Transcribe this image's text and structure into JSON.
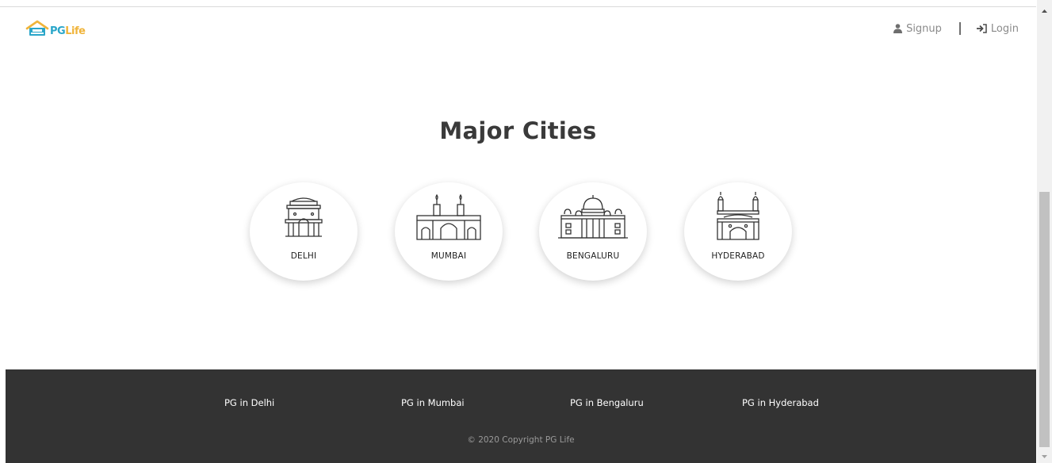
{
  "app": {
    "brand_pg": "PG",
    "brand_life": "Life"
  },
  "nav": {
    "signup_label": "Signup",
    "login_label": "Login"
  },
  "main": {
    "heading": "Major Cities",
    "cities": [
      {
        "name": "DELHI",
        "icon": "india-gate-icon"
      },
      {
        "name": "MUMBAI",
        "icon": "gateway-of-india-icon"
      },
      {
        "name": "BENGALURU",
        "icon": "vidhana-soudha-icon"
      },
      {
        "name": "HYDERABAD",
        "icon": "charminar-icon"
      }
    ]
  },
  "footer": {
    "links": [
      "PG in Delhi",
      "PG in Mumbai",
      "PG in Bengaluru",
      "PG in Hyderabad"
    ],
    "copyright": "© 2020 Copyright PG Life"
  },
  "colors": {
    "brand_blue": "#2aa6c9",
    "brand_yellow": "#f0b43a",
    "footer_bg": "#333333",
    "nav_text": "#8a8a8a"
  }
}
